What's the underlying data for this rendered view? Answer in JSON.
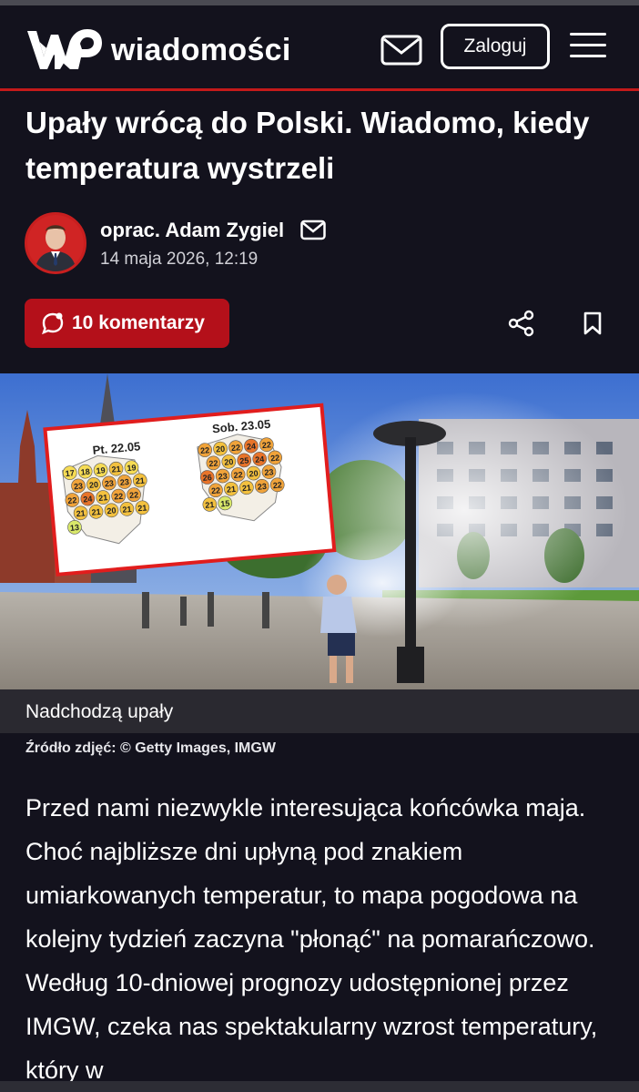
{
  "header": {
    "logo_text": "wiadomości",
    "login_label": "Zaloguj"
  },
  "article": {
    "title": "Upały wrócą do Polski. Wiadomo, kiedy temperatura wystrzeli",
    "author": "oprac. Adam Zygiel",
    "date": "14 maja 2026, 12:19",
    "comments_label": "10 komentarzy",
    "photo": {
      "map_left_title": "Pt. 22.05",
      "map_right_title": "Sob. 23.05",
      "map_left_values": [
        "17",
        "18",
        "19",
        "21",
        "19",
        "23",
        "20",
        "23",
        "23",
        "21",
        "22",
        "24",
        "21",
        "22",
        "22",
        "21",
        "21",
        "20",
        "21",
        "21",
        "13"
      ],
      "map_right_values": [
        "22",
        "20",
        "22",
        "24",
        "22",
        "22",
        "20",
        "25",
        "24",
        "22",
        "26",
        "23",
        "22",
        "20",
        "23",
        "22",
        "21",
        "21",
        "23",
        "22",
        "21",
        "15"
      ]
    },
    "caption": "Nadchodzą upały",
    "source": "Źródło zdjęć: © Getty Images, IMGW",
    "lead": "Przed nami niezwykle interesująca końcówka maja. Choć najbliższe dni upłyną pod znakiem umiarkowanych temperatur, to mapa pogodowa na kolejny tydzień zaczyna \"płonąć\" na pomarańczowo. Według 10-dniowej prognozy udostępnionej przez IMGW, czeka nas spektakularny wzrost temperatury, który w"
  },
  "colors": {
    "background": "#13121d",
    "accent_red": "#b4101a",
    "caption_bar": "#2a2930"
  },
  "icons": [
    "wp-logo-icon",
    "mail-icon",
    "menu-icon",
    "comment-icon",
    "share-icon",
    "bookmark-icon"
  ]
}
